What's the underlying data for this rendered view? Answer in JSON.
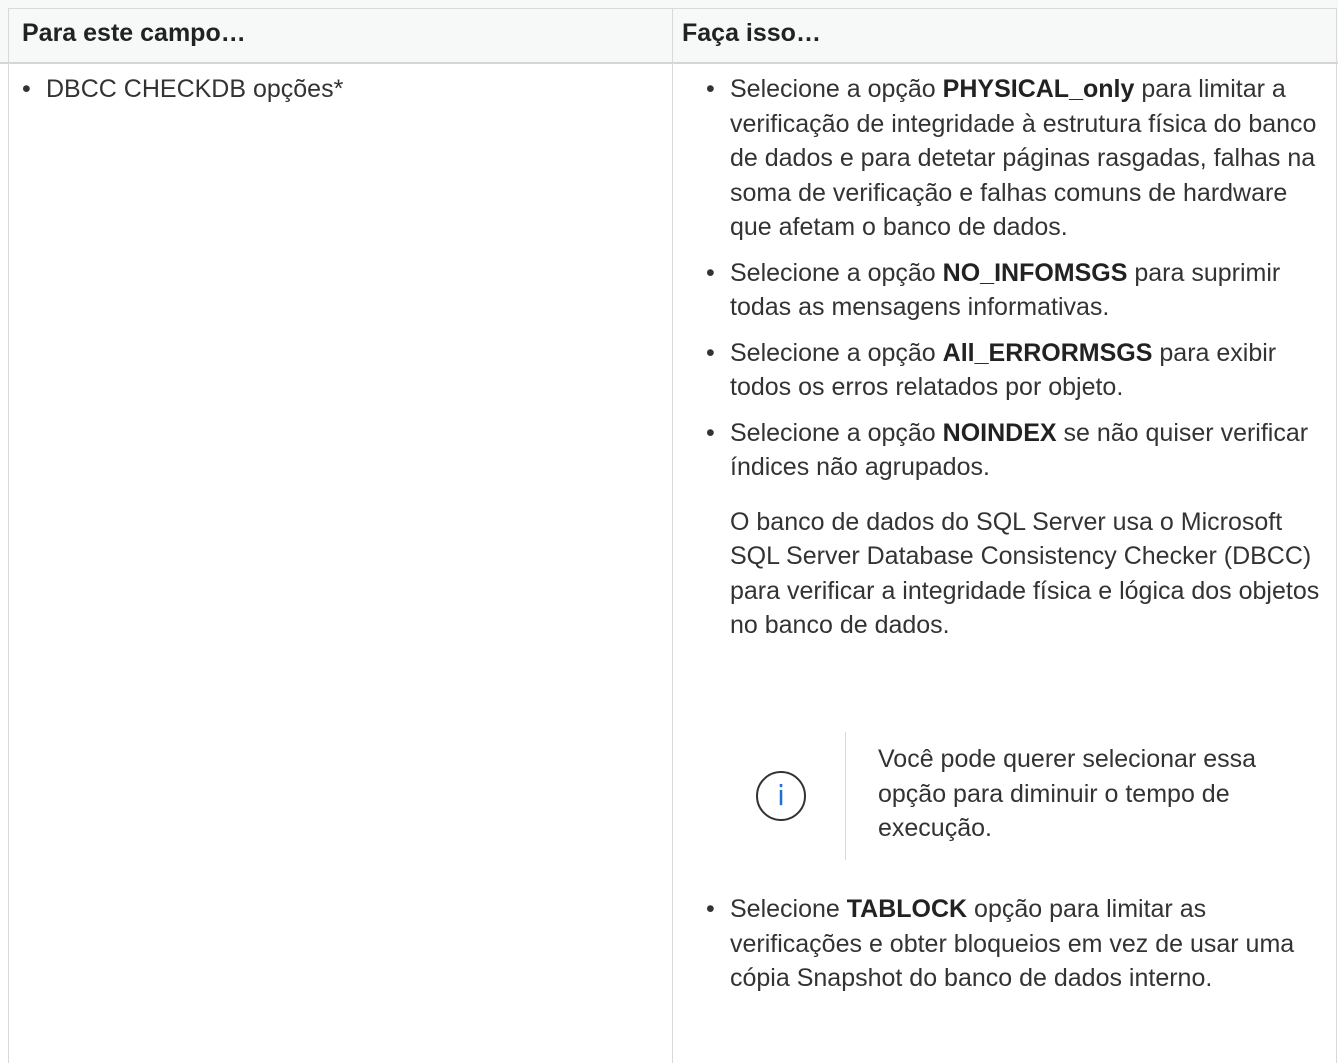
{
  "table": {
    "headers": [
      "Para este campo…",
      "Faça isso…"
    ],
    "field": "DBCC CHECKDB opções*",
    "bullet": "•",
    "options": [
      {
        "prefix": "Selecione a opção ",
        "bold": "PHYSICAL_only",
        "suffix": " para limitar a verificação de integridade à estrutura física do banco de dados e para detetar páginas rasgadas, falhas na soma de verificação e falhas comuns de hardware que afetam o banco de dados."
      },
      {
        "prefix": "Selecione a opção ",
        "bold": "NO_INFOMSGS",
        "suffix": " para suprimir todas as mensagens informativas."
      },
      {
        "prefix": "Selecione a opção ",
        "bold": "All_ERRORMSGS",
        "suffix": " para exibir todos os erros relatados por objeto."
      },
      {
        "prefix": "Selecione a opção ",
        "bold": "NOINDEX",
        "suffix": " se não quiser verificar índices não agrupados."
      }
    ],
    "paragraph": "O banco de dados do SQL Server usa o Microsoft SQL Server Database Consistency Checker (DBCC) para verificar a integridade física e lógica dos objetos no banco de dados.",
    "note": {
      "icon": "info-icon",
      "icon_glyph": "i",
      "icon_color": "#1e6fd9",
      "text": "Você pode querer selecionar essa opção para diminuir o tempo de execução."
    },
    "last_option": {
      "prefix": "Selecione ",
      "bold": "TABLOCK",
      "suffix": " opção para limitar as verificações e obter bloqueios em vez de usar uma cópia Snapshot do banco de dados interno."
    }
  }
}
